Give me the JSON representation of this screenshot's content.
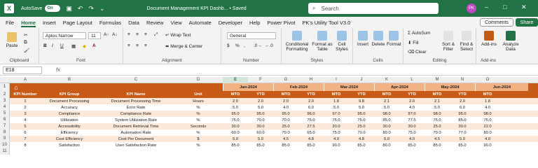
{
  "titlebar": {
    "autosave": "AutoSave",
    "toggle": "On",
    "title": "Document Management KPI Dashb... • Saved",
    "search_placeholder": "Search",
    "avatar": "PK"
  },
  "menu": [
    "File",
    "Home",
    "Insert",
    "Page Layout",
    "Formulas",
    "Data",
    "Review",
    "View",
    "Automate",
    "Developer",
    "Help",
    "Power Pivot",
    "PK's Utility Tool V3.0"
  ],
  "buttons": {
    "comments": "Comments",
    "share": "Share"
  },
  "ribbon": {
    "clipboard": {
      "paste": "Paste",
      "label": "Clipboard"
    },
    "font": {
      "name": "Aptos Narrow",
      "size": "11",
      "label": "Font"
    },
    "alignment": {
      "wrap": "Wrap Text",
      "merge": "Merge & Center",
      "label": "Alignment"
    },
    "number": {
      "format": "General",
      "label": "Number"
    },
    "styles": {
      "conditional": "Conditional Formatting",
      "table": "Format as Table",
      "cell": "Cell Styles",
      "label": "Styles"
    },
    "cells": {
      "insert": "Insert",
      "delete": "Delete",
      "format": "Format",
      "label": "Cells"
    },
    "editing": {
      "autosum": "AutoSum",
      "fill": "Fill",
      "clear": "Clear",
      "sort": "Sort & Filter",
      "find": "Find & Select",
      "label": "Editing"
    },
    "addins": {
      "addins": "Add-ins",
      "analyze": "Analyze Data",
      "label": "Add-ins"
    }
  },
  "formula_bar": {
    "name_box": "E18",
    "fx": "fx"
  },
  "columns": [
    "A",
    "B",
    "C",
    "D",
    "E",
    "F",
    "G",
    "H",
    "I",
    "J",
    "K",
    "L",
    "M",
    "N",
    "O"
  ],
  "months": [
    "Jan-2024",
    "Feb-2024",
    "Mar-2024",
    "Apr-2024",
    "May-2024",
    "Jun-2024"
  ],
  "headers": [
    "KPI Number",
    "KPI Group",
    "KPI Name",
    "Unit",
    "MTD",
    "YTD",
    "MTD",
    "YTD",
    "MTD",
    "YTD",
    "MTD",
    "YTD",
    "MTD",
    "YTD",
    "MTD"
  ],
  "rows": [
    [
      "1",
      "Document Processing",
      "Document Processing Time",
      "Hours",
      "2.0",
      "2.0",
      "2.0",
      "2.0",
      "1.8",
      "9.8",
      "2.1",
      "2.0",
      "2.1",
      "2.0",
      "1.8"
    ],
    [
      "2",
      "Accuracy",
      "Error Rate",
      "%",
      "5.0",
      "5.0",
      "4.0",
      "6.0",
      "5.0",
      "5.0",
      "5.0",
      "4.0",
      "5.0",
      "6.0",
      "4.0"
    ],
    [
      "3",
      "Compliance",
      "Compliance Rate",
      "%",
      "95.0",
      "95.0",
      "95.0",
      "96.0",
      "97.0",
      "95.0",
      "98.0",
      "97.0",
      "98.0",
      "95.0",
      "98.0"
    ],
    [
      "4",
      "Utilization",
      "System Utilization Rate",
      "%",
      "75.0",
      "70.0",
      "70.0",
      "75.0",
      "75.0",
      "75.0",
      "85.0",
      "77.5",
      "75.0",
      "85.0",
      "75.0"
    ],
    [
      "5",
      "Accessibility",
      "Document Retrieval Time",
      "Seconds",
      "30.0",
      "30.0",
      "25.0",
      "27.5",
      "20.0",
      "25.0",
      "30.0",
      "30.0",
      "25.0",
      "30.0",
      "22.0"
    ],
    [
      "6",
      "Efficiency",
      "Automation Rate",
      "%",
      "60.0",
      "60.0",
      "70.0",
      "65.0",
      "75.0",
      "70.0",
      "80.0",
      "75.0",
      "70.0",
      "77.0",
      "80.0"
    ],
    [
      "7",
      "Cost Efficiency",
      "Cost Per Document",
      "$",
      "5.0",
      "5.0",
      "4.5",
      "4.8",
      "4.0",
      "4.8",
      "5.0",
      "4.0",
      "4.5",
      "5.0",
      "4.0"
    ],
    [
      "8",
      "Satisfaction",
      "User Satisfaction Rate",
      "%",
      "85.0",
      "85.0",
      "85.0",
      "85.0",
      "90.0",
      "85.0",
      "80.0",
      "85.0",
      "85.0",
      "85.0",
      "90.0"
    ]
  ],
  "row_numbers": [
    "1",
    "2",
    "3",
    "4",
    "5",
    "6",
    "7",
    "8",
    "9",
    "10",
    "11"
  ],
  "colors": {
    "brand": "#217346",
    "header_dark": "#c85a18",
    "header_light": "#f4b183",
    "row_light": "#fde9d9",
    "row_white": "#ffffff"
  }
}
